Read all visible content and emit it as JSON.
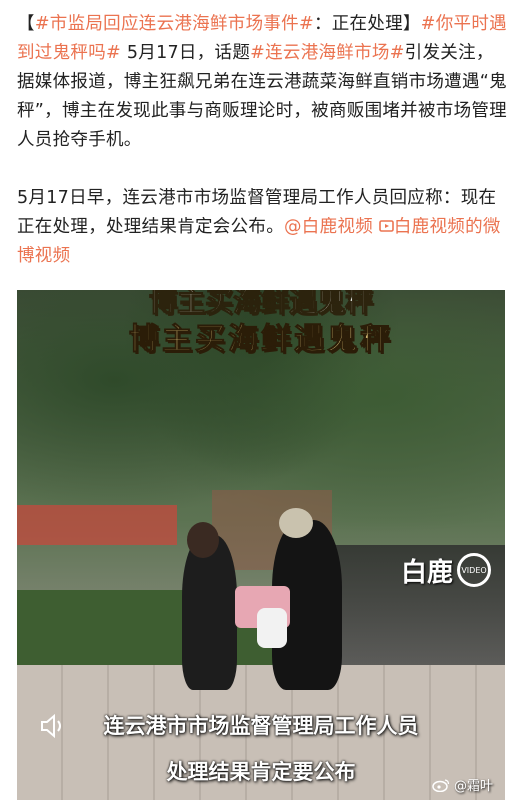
{
  "post": {
    "p1": {
      "open_bracket": "【",
      "topic1": "#市监局回应连云港海鲜市场事件#",
      "text1": "：正在处理】",
      "topic2": "#你平时遇到过鬼秤吗#",
      "text2": " 5月17日，话题",
      "topic3": "#连云港海鲜市场#",
      "text3": "引发关注，据媒体报道，博主狂飙兄弟在连云港蔬菜海鲜直销市场遭遇“鬼秤”，博主在发现此事与商贩理论时，被商贩围堵并被市场管理人员抢夺手机。"
    },
    "p2": {
      "text": "5月17日早，连云港市市场监督管理局工作人员回应称：现在正在处理，处理结果肯定会公布。",
      "mention": "@白鹿视频",
      "link": "白鹿视频的微博视频"
    }
  },
  "video": {
    "headline_top": "博主买海鲜遇鬼秤",
    "headline_main": "博主买海鲜遇鬼秤",
    "watermark_text": "白鹿",
    "watermark_small": "VIDEO",
    "caption_line1": "连云港市市场监督管理局工作人员",
    "caption_line2": "处理结果肯定要公布",
    "weibo_watermark": "@霜叶"
  },
  "colors": {
    "accent": "#eb7350",
    "text": "#222222"
  }
}
